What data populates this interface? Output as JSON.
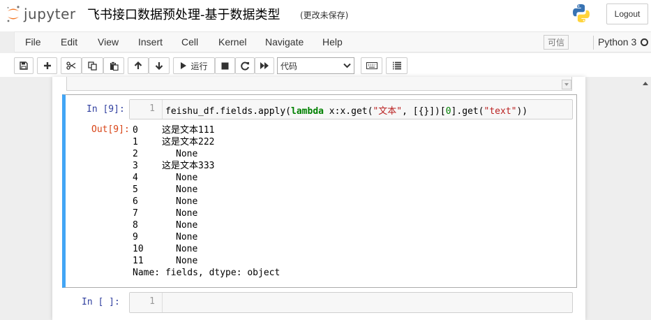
{
  "header": {
    "logo_text": "jupyter",
    "notebook_name": "飞书接口数据预处理-基于数据类型",
    "save_status": "(更改未保存)",
    "logout_label": "Logout"
  },
  "menubar": {
    "items": [
      "File",
      "Edit",
      "View",
      "Insert",
      "Cell",
      "Kernel",
      "Navigate",
      "Help"
    ],
    "trusted_label": "可信",
    "kernel_name": "Python 3"
  },
  "toolbar": {
    "run_label": "运行",
    "cell_type": "代码"
  },
  "cells": {
    "active": {
      "in_prompt": "In  [9]:",
      "line_number": "1",
      "code_parts": {
        "p1": "feishu_df.fields.apply(",
        "kw": "lambda",
        "p2": " x:x.get(",
        "s1": "\"文本\"",
        "p3": ", [{}])[",
        "n0": "0",
        "p4": "].get(",
        "s2": "\"text\"",
        "p5": "))"
      },
      "out_prompt": "Out[9]:",
      "output_rows": [
        {
          "index": "0",
          "value": "这是文本111"
        },
        {
          "index": "1",
          "value": "这是文本222"
        },
        {
          "index": "2",
          "value": "None"
        },
        {
          "index": "3",
          "value": "这是文本333"
        },
        {
          "index": "4",
          "value": "None"
        },
        {
          "index": "5",
          "value": "None"
        },
        {
          "index": "6",
          "value": "None"
        },
        {
          "index": "7",
          "value": "None"
        },
        {
          "index": "8",
          "value": "None"
        },
        {
          "index": "9",
          "value": "None"
        },
        {
          "index": "10",
          "value": "None"
        },
        {
          "index": "11",
          "value": "None"
        }
      ],
      "output_footer": "Name: fields, dtype: object"
    },
    "empty": {
      "in_prompt": "In  [ ]:",
      "line_number": "1"
    }
  },
  "colors": {
    "selected_border": "#42a5f5",
    "in_prompt": "#303f9f",
    "out_prompt": "#d84315",
    "keyword": "#008000",
    "string": "#ba2121"
  }
}
